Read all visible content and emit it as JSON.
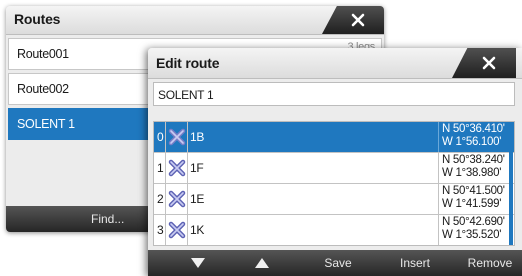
{
  "routes_window": {
    "title": "Routes",
    "close_icon": "close-x-icon",
    "routes": [
      {
        "name": "Route001",
        "legs": "3 legs",
        "selected": false
      },
      {
        "name": "Route002",
        "legs": "",
        "selected": false
      },
      {
        "name": "SOLENT 1",
        "legs": "",
        "selected": true
      }
    ],
    "find_label": "Find..."
  },
  "edit_window": {
    "title": "Edit route",
    "close_icon": "close-x-icon",
    "route_name": "SOLENT 1",
    "waypoints": [
      {
        "index": "0",
        "icon": "waypoint-cross-icon",
        "name": "1B",
        "lat": "N 50°36.410'",
        "lon": "W 1°56.100'",
        "selected": true
      },
      {
        "index": "1",
        "icon": "waypoint-cross-icon",
        "name": "1F",
        "lat": "N 50°38.240'",
        "lon": "W 1°38.980'",
        "selected": false
      },
      {
        "index": "2",
        "icon": "waypoint-cross-icon",
        "name": "1E",
        "lat": "N 50°41.500'",
        "lon": "W 1°41.599'",
        "selected": false
      },
      {
        "index": "3",
        "icon": "waypoint-cross-icon",
        "name": "1K",
        "lat": "N 50°42.690'",
        "lon": "W 1°35.520'",
        "selected": false
      }
    ],
    "buttons": {
      "down_icon": "triangle-down-icon",
      "up_icon": "triangle-up-icon",
      "save": "Save",
      "insert": "Insert",
      "remove": "Remove"
    }
  },
  "colors": {
    "selection": "#1f78bf",
    "bar_dark": "#262626",
    "panel_bg": "#ececec",
    "waypoint_icon": "#7a7fc8"
  }
}
